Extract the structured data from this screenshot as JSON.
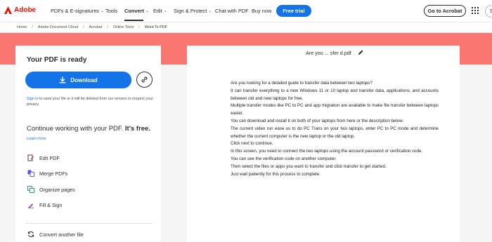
{
  "nav": {
    "brand": "Adobe",
    "items": [
      {
        "label": "PDFs & E-signatures",
        "chevron": true
      },
      {
        "label": "Tools",
        "chevron": false
      },
      {
        "label": "Convert",
        "chevron": true,
        "active": true
      },
      {
        "label": "Edit",
        "chevron": true
      },
      {
        "label": "Sign & Protect",
        "chevron": true
      },
      {
        "label": "Chat with PDF",
        "chevron": false
      },
      {
        "label": "Buy now",
        "chevron": false
      }
    ],
    "trial_label": "Free trial",
    "go_label": "Go to Acrobat",
    "avatar_initial": "S",
    "colors": {
      "brand": "#eb1000",
      "accent": "#1473e6",
      "band": "#fa7671"
    }
  },
  "breadcrumb": [
    "Home",
    "Adobe Document Cloud",
    "Acrobat",
    "Online Tools",
    "Word To PDF"
  ],
  "panel": {
    "title": "Your PDF is ready",
    "download_label": "Download",
    "signin_link": "Sign in",
    "signin_rest": " to save your file or it will be deleted from our servers to respect your privacy.",
    "continue_text": "Continue working with your PDF. ",
    "continue_bold": "It's free.",
    "learn_more": "Learn more",
    "tools": [
      {
        "label": "Edit PDF",
        "icon": "edit-pdf-icon"
      },
      {
        "label": "Merge PDFs",
        "icon": "merge-pdfs-icon"
      },
      {
        "label": "Organize pages",
        "icon": "organize-pages-icon"
      },
      {
        "label": "Fill & Sign",
        "icon": "fill-sign-icon"
      }
    ],
    "convert_another": "Convert another file"
  },
  "document": {
    "filename": "Are you ... sfer d.pdf",
    "paragraphs": [
      "Are you looking for a detailed guide to transfer data between two laptops?",
      "It can transfer everything to a new Windows 11 or 10 laptop and transfer data, applications, and accounts between old and new laptops for free.",
      "Multiple transfer modes like PC to PC and app migration are available to make file transfer between laptops easier.",
      "You can download and install it on both of your laptops from here or the description below.",
      "The current video run ease us to do PC Trans on your two laptops, enter PC to PC mode and determine whether the current computer is the new laptop or the old laptop.",
      "Click next to continue.",
      "In this screen, you need to connect the two laptops using the account password or verification code.",
      "You can see the verification code on another computer.",
      "Then select the files or apps you want to transfer and click transfer to get started.",
      "Just wait patiently for this process to complete."
    ]
  }
}
